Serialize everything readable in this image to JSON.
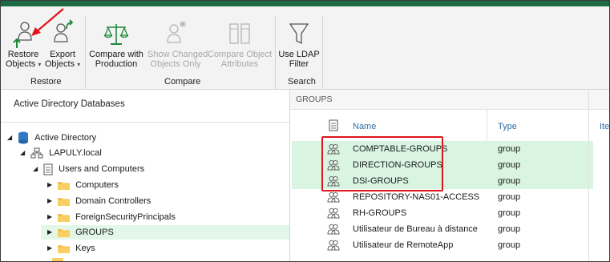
{
  "ribbon": {
    "restore_objects": {
      "line1": "Restore",
      "line2": "Objects"
    },
    "export_objects": {
      "line1": "Export",
      "line2": "Objects"
    },
    "group_restore": "Restore",
    "compare_with_production": {
      "line1": "Compare with",
      "line2": "Production"
    },
    "show_changed_objects_only": {
      "line1": "Show Changed",
      "line2": "Objects Only"
    },
    "compare_object_attributes": {
      "line1": "Compare Object",
      "line2": "Attributes"
    },
    "group_compare": "Compare",
    "use_ldap_filter": {
      "line1": "Use LDAP",
      "line2": "Filter"
    },
    "group_search": "Search",
    "caret": "▾"
  },
  "tree": {
    "title": "Active Directory Databases",
    "nodes": [
      {
        "label": "Active Directory",
        "toggle": "◢"
      },
      {
        "label": "LAPULY.local",
        "toggle": "◢"
      },
      {
        "label": "Users and Computers",
        "toggle": "◢"
      },
      {
        "label": "Computers",
        "toggle": "▶"
      },
      {
        "label": "Domain Controllers",
        "toggle": "▶"
      },
      {
        "label": "ForeignSecurityPrincipals",
        "toggle": "▶"
      },
      {
        "label": "GROUPS",
        "toggle": "▶"
      },
      {
        "label": "Keys",
        "toggle": "▶"
      }
    ]
  },
  "list": {
    "header": "GROUPS",
    "columns": {
      "name": "Name",
      "type": "Type",
      "extra": "Ite"
    },
    "rows": [
      {
        "name": "COMPTABLE-GROUPS",
        "type": "group"
      },
      {
        "name": "DIRECTION-GROUPS",
        "type": "group"
      },
      {
        "name": "DSI-GROUPS",
        "type": "group"
      },
      {
        "name": "REPOSITORY-NAS01-ACCESS",
        "type": "group"
      },
      {
        "name": "RH-GROUPS",
        "type": "group"
      },
      {
        "name": "Utilisateur de Bureau à distance",
        "type": "group"
      },
      {
        "name": "Utilisateur de RemoteApp",
        "type": "group"
      }
    ]
  },
  "colors": {
    "accent": "#1c6b45",
    "highlight": "#d9f5e2",
    "annotation": "#e0161c",
    "link": "#2e6fa5"
  }
}
